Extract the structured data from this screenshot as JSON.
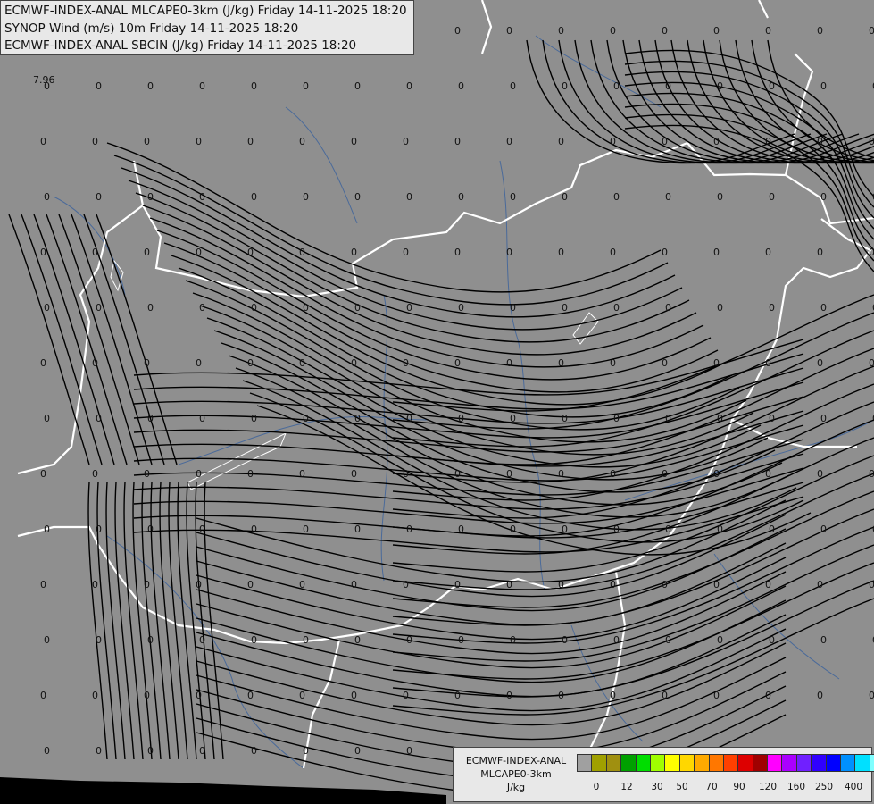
{
  "header": {
    "line1": "ECMWF-INDEX-ANAL MLCAPE0-3km (J/kg) Friday 14-11-2025 18:20",
    "line2": "SYNOP Wind (m/s) 10m Friday 14-11-2025 18:20",
    "line3": "ECMWF-INDEX-ANAL SBCIN (J/kg) Friday 14-11-2025 18:20"
  },
  "legend": {
    "title_line1": "ECMWF-INDEX-ANAL",
    "title_line2": "MLCAPE0-3km",
    "unit": "J/kg",
    "colors": [
      "#a0a0a0",
      "#a0a000",
      "#a09010",
      "#00a000",
      "#00dd00",
      "#a0ff00",
      "#ffff00",
      "#ffd700",
      "#ffaa00",
      "#ff7700",
      "#ff4000",
      "#dd0000",
      "#a00000",
      "#ff00ff",
      "#aa00ff",
      "#7020ff",
      "#3000ff",
      "#0000ff",
      "#0090ff",
      "#00e0ff",
      "#80ffff",
      "#ffffff"
    ],
    "tick_labels": [
      "0",
      "12",
      "30",
      "50",
      "70",
      "90",
      "120",
      "160",
      "250",
      "400"
    ]
  },
  "map": {
    "colors": {
      "background": "#8f8f8f",
      "country_border": "#ffffff",
      "river": "#4a6a9a",
      "streamline": "#000000",
      "sea": "#000000"
    },
    "special_label": "7.96",
    "value_label": "0"
  }
}
